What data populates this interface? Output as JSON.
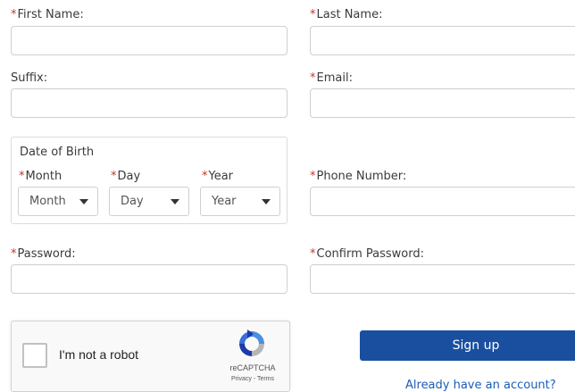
{
  "form": {
    "required_mark": "*",
    "first_name_label": "First Name:",
    "last_name_label": "Last Name:",
    "suffix_label": "Suffix:",
    "email_label": "Email:",
    "dob_heading": "Date of Birth",
    "month_label": "Month",
    "day_label": "Day",
    "year_label": "Year",
    "month_selected": "Month",
    "day_selected": "Day",
    "year_selected": "Year",
    "phone_label": "Phone Number:",
    "password_label": "Password:",
    "confirm_password_label": "Confirm Password:"
  },
  "captcha": {
    "text": "I'm not a robot",
    "brand": "reCAPTCHA",
    "links": "Privacy - Terms"
  },
  "actions": {
    "signup_label": "Sign up",
    "login_link": "Already have an account?"
  },
  "colors": {
    "primary": "#1a4fa0",
    "required": "#c0392b",
    "link": "#1a5cb8"
  }
}
